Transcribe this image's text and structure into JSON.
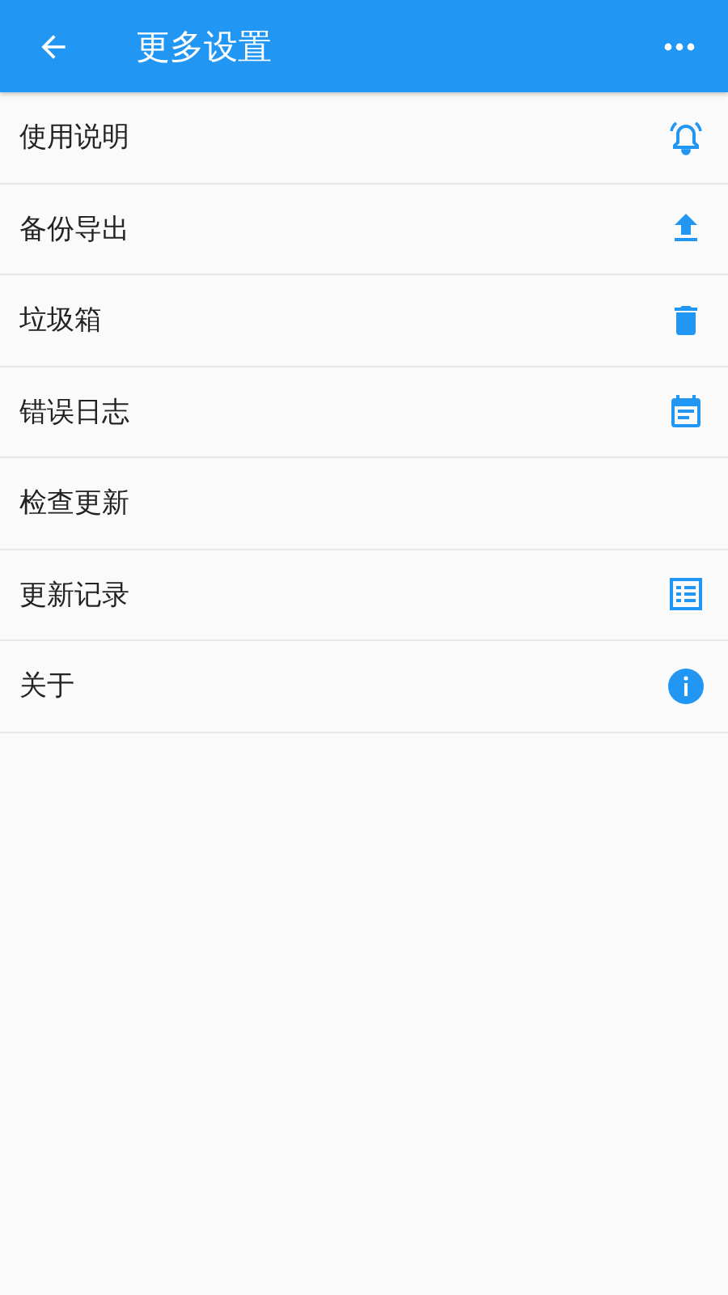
{
  "app_bar": {
    "title": "更多设置"
  },
  "items": [
    {
      "label": "使用说明",
      "kind": "alarm"
    },
    {
      "label": "备份导出",
      "kind": "upload"
    },
    {
      "label": "垃圾箱",
      "kind": "trash"
    },
    {
      "label": "错误日志",
      "kind": "calendar"
    },
    {
      "label": "检查更新",
      "kind": "plain"
    },
    {
      "label": "更新记录",
      "kind": "list"
    },
    {
      "label": "关于",
      "kind": "info"
    }
  ]
}
